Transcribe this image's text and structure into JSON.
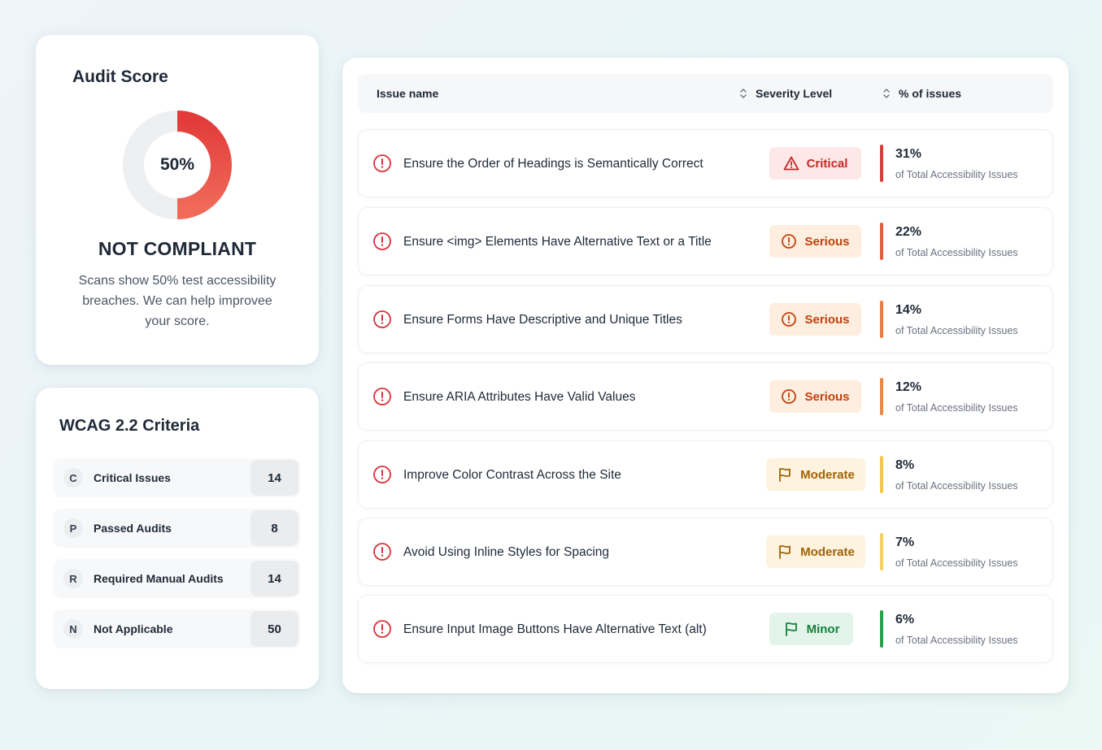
{
  "audit": {
    "title": "Audit Score",
    "score_label": "50%",
    "score_fraction": 0.5,
    "status": "NOT COMPLIANT",
    "description": "Scans show 50% test accessibility breaches. We can help improvee your score.",
    "colors": {
      "filled": "#e8463f",
      "track": "#eeeff1"
    }
  },
  "wcag": {
    "title": "WCAG 2.2 Criteria",
    "items": [
      {
        "letter": "C",
        "label": "Critical Issues",
        "count": "14"
      },
      {
        "letter": "P",
        "label": "Passed Audits",
        "count": "8"
      },
      {
        "letter": "R",
        "label": "Required Manual Audits",
        "count": "14"
      },
      {
        "letter": "N",
        "label": "Not Applicable",
        "count": "50"
      }
    ]
  },
  "table": {
    "headers": {
      "issue": "Issue name",
      "severity": "Severity Level",
      "percent": "% of issues"
    },
    "rows": [
      {
        "name": "Ensure the Order of Headings is Semantically Correct",
        "severity": "Critical",
        "severity_key": "critical",
        "icon": "warning-triangle-icon",
        "percent": "31%",
        "sub": "of Total Accessibility Issues",
        "bar_color": "#d93a3a"
      },
      {
        "name": "Ensure <img> Elements Have Alternative Text or a Title",
        "severity": "Serious",
        "severity_key": "serious",
        "icon": "alert-circle-icon",
        "percent": "22%",
        "sub": "of Total Accessibility Issues",
        "bar_color": "#e85a3c"
      },
      {
        "name": "Ensure Forms Have Descriptive and Unique Titles",
        "severity": "Serious",
        "severity_key": "serious",
        "icon": "alert-circle-icon",
        "percent": "14%",
        "sub": "of Total Accessibility Issues",
        "bar_color": "#ec7a3f"
      },
      {
        "name": "Ensure ARIA Attributes Have Valid Values",
        "severity": "Serious",
        "severity_key": "serious",
        "icon": "alert-circle-icon",
        "percent": "12%",
        "sub": "of Total Accessibility Issues",
        "bar_color": "#ef8640"
      },
      {
        "name": "Improve Color Contrast Across the Site",
        "severity": "Moderate",
        "severity_key": "moderate",
        "icon": "flag-icon",
        "percent": "8%",
        "sub": "of Total Accessibility Issues",
        "bar_color": "#f4c74a"
      },
      {
        "name": "Avoid Using Inline Styles for Spacing",
        "severity": "Moderate",
        "severity_key": "moderate",
        "icon": "flag-icon",
        "percent": "7%",
        "sub": "of Total Accessibility Issues",
        "bar_color": "#f6cf5c"
      },
      {
        "name": "Ensure Input Image Buttons Have Alternative Text (alt)",
        "severity": "Minor",
        "severity_key": "minor",
        "icon": "flag-icon",
        "percent": "6%",
        "sub": "of Total Accessibility Issues",
        "bar_color": "#22a24a"
      }
    ]
  }
}
